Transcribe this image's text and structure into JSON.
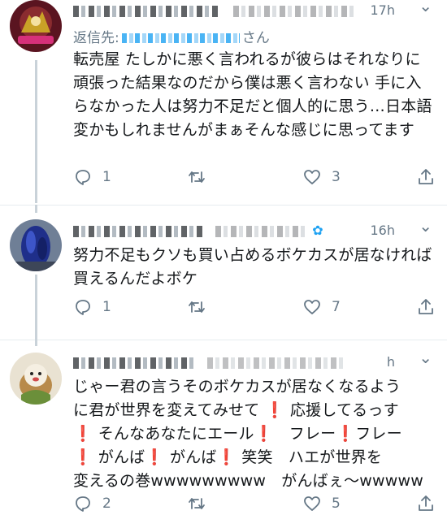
{
  "tweets": [
    {
      "time": "17h",
      "reply_prefix": "返信先:",
      "reply_suffix": "さん",
      "text": "転売屋 たしかに悪く言われるが彼らはそれなりに頑張った結果なのだから僕は悪く言わない 手に入らなかった人は努力不足だと個人的に思う…日本語変かもしれませんがまぁそんな感じに思ってます",
      "reply_count": "1",
      "like_count": "3",
      "avatar_colors": [
        "#7a1e2c",
        "#c9a227"
      ]
    },
    {
      "time": "16h",
      "text": "努力不足もクソも買い占めるボケカスが居なければ買えるんだよボケ",
      "reply_count": "1",
      "like_count": "7",
      "avatar_colors": [
        "#2b3a8f",
        "#8fa1b7"
      ]
    },
    {
      "time": "h",
      "text_lines": [
        "じゃー君の言うそのボケカスが居なくなるよう",
        "に君が世界を変えてみせて",
        "応援してるっす",
        "そんなあなたにエール",
        "フレー",
        "フレー",
        "がんば",
        "がんば",
        "笑笑　ハエが世界を",
        "変えるの巻wwwwwwwww　がんばぇ〜wwwww"
      ],
      "reply_count": "2",
      "like_count": "5",
      "avatar_colors": [
        "#d9c9a8",
        "#6b8f3a"
      ]
    }
  ],
  "icons": {
    "reply": "reply-icon",
    "retweet": "retweet-icon",
    "like": "heart-icon",
    "share": "share-icon",
    "caret": "chevron-down-icon"
  },
  "colors": {
    "muted": "#657786",
    "link": "#1da1f2",
    "thread_line": "#c9d2d9",
    "exclamation": "#d0021b"
  }
}
